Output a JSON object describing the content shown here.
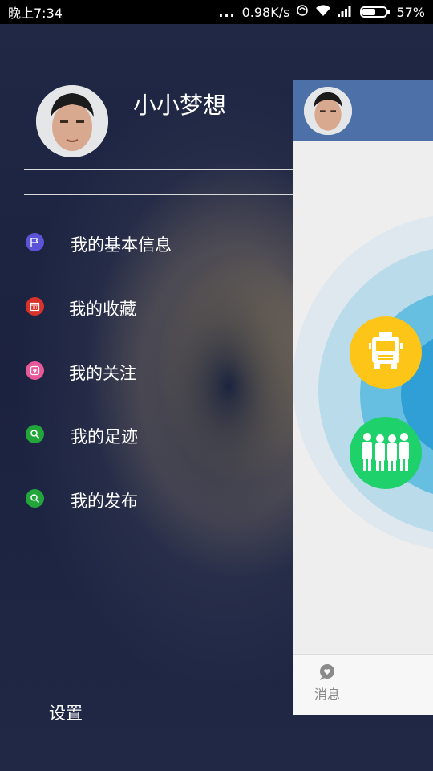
{
  "status_bar": {
    "time": "晚上7:34",
    "dots": "...",
    "network_speed": "0.98K/s",
    "battery_percent": "57%",
    "battery_level": 0.57
  },
  "drawer": {
    "username": "小小梦想",
    "menu_items": [
      {
        "label": "我的基本信息",
        "icon": "flag-icon",
        "color": "#5b54d9"
      },
      {
        "label": "我的收藏",
        "icon": "calendar-icon",
        "color": "#d9322b"
      },
      {
        "label": "我的关注",
        "icon": "heart-square-icon",
        "color": "#e8589a"
      },
      {
        "label": "我的足迹",
        "icon": "search-icon",
        "color": "#22a63c"
      },
      {
        "label": "我的发布",
        "icon": "search-icon",
        "color": "#22a63c"
      }
    ],
    "settings_label": "设置"
  },
  "main": {
    "header_color": "#4c70a7",
    "buttons": [
      {
        "icon": "bus-icon",
        "color": "#fcc517"
      },
      {
        "icon": "group-icon",
        "color": "#1fd16b"
      }
    ],
    "bottom_nav": {
      "messages_label": "消息",
      "messages_icon": "chat-heart-icon"
    }
  }
}
